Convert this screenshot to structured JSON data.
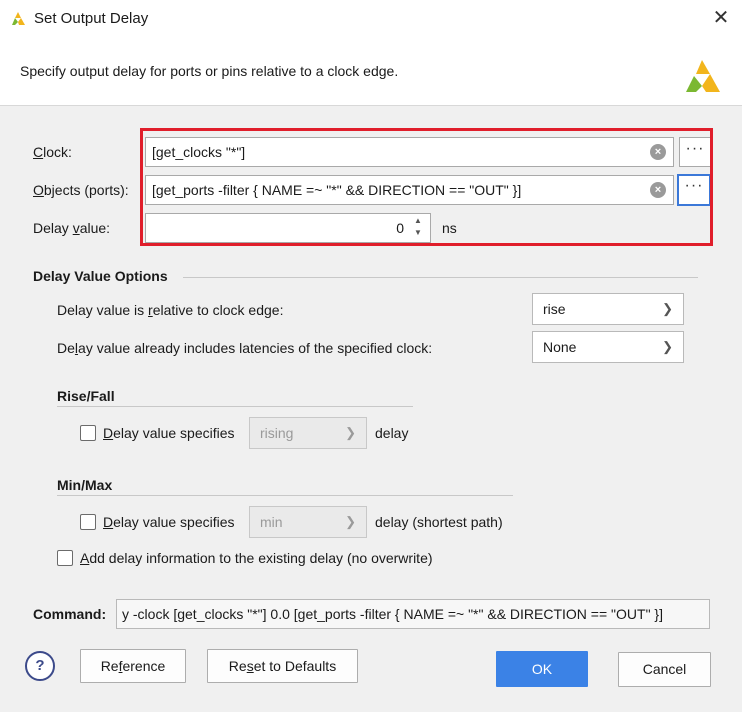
{
  "window": {
    "title": "Set Output Delay"
  },
  "header": {
    "description": "Specify output delay for ports or pins relative to a clock edge."
  },
  "form": {
    "clock": {
      "label_pre": "",
      "label_u": "C",
      "label_post": "lock:",
      "value": "[get_clocks  \"*\"]"
    },
    "objects": {
      "label_pre": "",
      "label_u": "O",
      "label_post": "bjects (ports):",
      "value": "[get_ports -filter { NAME =~  \"*\" && DIRECTION == \"OUT\" }]"
    },
    "delay": {
      "label_pre": "Delay ",
      "label_u": "v",
      "label_post": "alue:",
      "value": "0",
      "unit": "ns"
    },
    "more_glyph": "···",
    "clear_glyph": "×"
  },
  "options": {
    "title": "Delay Value Options",
    "relative": {
      "label_pre": "Delay value is ",
      "label_u": "r",
      "label_post": "elative to clock edge:",
      "value": "rise"
    },
    "latency": {
      "label_pre": "De",
      "label_u": "l",
      "label_post": "ay value already includes latencies of the specified clock:",
      "value": "None"
    },
    "risefall": {
      "title": "Rise/Fall",
      "check_pre": "",
      "check_u": "D",
      "check_post": "elay value specifies",
      "value": "rising",
      "suffix": "delay"
    },
    "minmax": {
      "title": "Min/Max",
      "check_pre": "",
      "check_u": "D",
      "check_post": "elay value specifies",
      "value": "min",
      "suffix": "delay (shortest path)"
    },
    "add": {
      "label_pre": "",
      "label_u": "A",
      "label_post": "dd delay information to the existing delay (no overwrite)"
    }
  },
  "command": {
    "label": "Command:",
    "value": "y -clock [get_clocks  \"*\"] 0.0 [get_ports -filter { NAME =~  \"*\" && DIRECTION == \"OUT\" }]"
  },
  "buttons": {
    "help": "?",
    "reference_pre": "Re",
    "reference_u": "f",
    "reference_post": "erence",
    "reset_pre": "Re",
    "reset_u": "s",
    "reset_post": "et to Defaults",
    "ok": "OK",
    "cancel": "Cancel"
  },
  "colors": {
    "highlight": "#e01e2b",
    "primary": "#3b82e6",
    "focus": "#3b78d8"
  },
  "icons": {
    "app": "vivado-logo-icon",
    "close": "close-icon",
    "chevron": "chevron-down-icon"
  }
}
